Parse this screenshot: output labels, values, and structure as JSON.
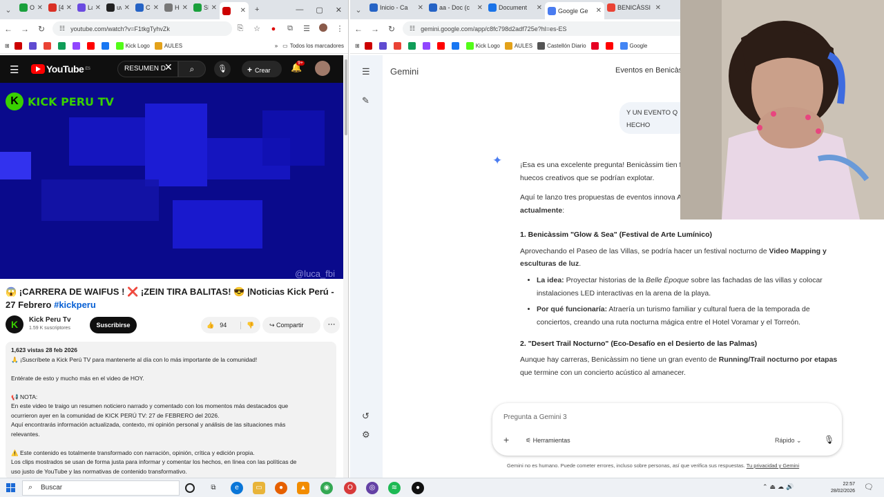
{
  "left_browser": {
    "tabs": [
      {
        "label": "Ov",
        "color": "#1aa03c"
      },
      {
        "label": "[48",
        "color": "#d93025"
      },
      {
        "label": "La",
        "color": "#6b4be0"
      },
      {
        "label": "uw",
        "color": "#222222"
      },
      {
        "label": "Co",
        "color": "#2563c5"
      },
      {
        "label": "Ho",
        "color": "#777777"
      },
      {
        "label": "SIE",
        "color": "#1aa03c"
      },
      {
        "label": "",
        "color": "#cc0000"
      }
    ],
    "url": "youtube.com/watch?v=F1tkgTyhvZk",
    "bookmarks": [
      {
        "label": "",
        "color": "#cc0000"
      },
      {
        "label": "",
        "color": "#5f4bd1"
      },
      {
        "label": "",
        "color": "#ea4335"
      },
      {
        "label": "",
        "color": "#0f9d58"
      },
      {
        "label": "",
        "color": "#9146ff"
      },
      {
        "label": "",
        "color": "#ff0000"
      },
      {
        "label": "",
        "color": "#1877f2"
      },
      {
        "label": "Kick Logo",
        "color": "#53fc18"
      },
      {
        "label": "AULES",
        "color": "#e3a21a"
      }
    ],
    "bookmarks_folder": "Todos los marcadores"
  },
  "youtube": {
    "logo": "YouTube",
    "region": "ES",
    "search_value": "RESUMEN D",
    "create_label": "Crear",
    "notif_count": "9+",
    "video_overlay": "KICK PERU TV",
    "video_watermark": "@luca_fbi",
    "title": "😱 ¡CARRERA DE WAIFUS ! ❌ ¡ZEIN TIRA BALITAS! 😎 |Noticias Kick Perú - 27 Febrero ",
    "hashtag": "#kickperu",
    "channel_name": "Kick Peru Tv",
    "subscribers": "1.59 K suscriptores",
    "subscribe_label": "Suscribirse",
    "likes": "94",
    "share_label": "Compartir",
    "desc_meta": "1,623 vistas  28 feb 2026",
    "desc_lines": [
      "🙏 ¡Suscríbete a Kick Perú TV para mantenerte al día con lo más importante de la comunidad!",
      "",
      "Entérate de esto y mucho más en el video de HOY.",
      "",
      "📢 NOTA:",
      "En este video te traigo un resumen noticiero narrado y comentado con los momentos más destacados que",
      "ocurrieron ayer en la comunidad de KICK PERÚ TV: 27 de FEBRERO del 2026.",
      "Aquí encontrarás información actualizada, contexto, mi opinión personal y análisis de las situaciones más",
      "relevantes.",
      "",
      "⚠️ Este contenido es totalmente transformado con narración, opinión, crítica y edición propia.",
      "Los clips mostrados se usan de forma justa para informar y comentar los hechos, en línea con las políticas de",
      "uso justo de YouTube y las normativas de contenido transformativo."
    ]
  },
  "right_browser": {
    "tabs": [
      {
        "label": "Inicio - Ca",
        "color": "#2563c5"
      },
      {
        "label": "aa - Doc (c",
        "color": "#2563c5"
      },
      {
        "label": "Document",
        "color": "#1a73e8"
      },
      {
        "label": "Google Ge",
        "color": "#4a7cf0"
      },
      {
        "label": "BENICÀSSI",
        "color": "#ea4335"
      }
    ],
    "url": "gemini.google.com/app/c8fc798d2adf725e?hl=es-ES",
    "bookmarks": [
      {
        "label": "",
        "color": "#cc0000"
      },
      {
        "label": "",
        "color": "#5f4bd1"
      },
      {
        "label": "",
        "color": "#ea4335"
      },
      {
        "label": "",
        "color": "#0f9d58"
      },
      {
        "label": "",
        "color": "#9146ff"
      },
      {
        "label": "",
        "color": "#ff0000"
      },
      {
        "label": "",
        "color": "#1877f2"
      },
      {
        "label": "Kick Logo",
        "color": "#53fc18"
      },
      {
        "label": "AULES",
        "color": "#e3a21a"
      },
      {
        "label": "Castellón Diario",
        "color": "#555555"
      },
      {
        "label": "",
        "color": "#e60023"
      },
      {
        "label": "",
        "color": "#ff0000"
      },
      {
        "label": "Google",
        "color": "#4285f4"
      }
    ]
  },
  "gemini": {
    "app_title": "Gemini",
    "chat_title": "Eventos en Benicàs",
    "user_msg": "Y UN EVENTO Q HECHO",
    "p1": "¡Esa es una excelente pregunta! Benicàssim tien festivales, las villas modernistas, el Desierto de l huecos creativos que se podrían explotar.",
    "p2a": "Aquí te lanzo tres propuestas de eventos innova ADN de la ciudad pero que ",
    "p2b": "no existen actualmente",
    ":": ":",
    "h1": "1. Benicàssim \"Glow & Sea\" (Festival de Arte Lumínico)",
    "p3a": "Aprovechando el Paseo de las Villas, se podría hacer un festival nocturno de ",
    "p3b": "Video Mapping y esculturas de luz",
    "li1_label": "La idea:",
    "li1_a": " Proyectar historias de la ",
    "li1_em": "Belle Époque",
    "li1_b": " sobre las fachadas de las villas y colocar instalaciones LED interactivas en la arena de la playa.",
    "li2_label": "Por qué funcionaría:",
    "li2_text": " Atraería un turismo familiar y cultural fuera de la temporada de conciertos, creando una ruta nocturna mágica entre el Hotel Voramar y el Torreón.",
    "h2": "2. \"Desert Trail Nocturno\" (Eco-Desafío en el Desierto de las Palmas)",
    "p4a": "Aunque hay carreras, Benicàssim no tiene un gran evento de ",
    "p4b": "Running/Trail nocturno por etapas",
    "p4c": " que termine con un concierto acústico al amanecer.",
    "composer_placeholder": "Pregunta a Gemini 3",
    "tools_label": "Herramientas",
    "mode_label": "Rápido",
    "disclaimer": "Gemini no es humano. Puede cometer errores, incluso sobre personas, así que verifica sus respuestas. ",
    "privacy_link": "Tu privacidad y Gemini"
  },
  "taskbar": {
    "search_label": "Buscar",
    "time": "22:57",
    "date": "28/02/2026"
  }
}
